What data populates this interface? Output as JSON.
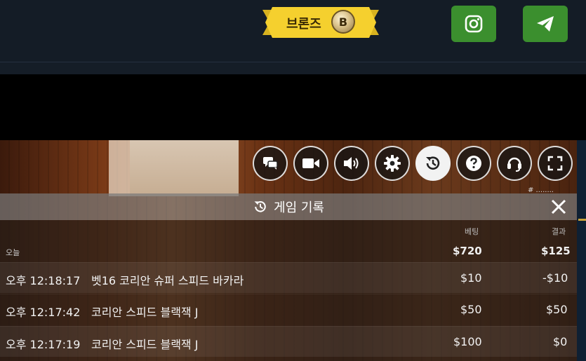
{
  "header": {
    "rank_label": "브론즈",
    "rank_coin_letter": "B",
    "rank_badge_color": "#f5d02e",
    "social": [
      {
        "name": "instagram-icon",
        "color": "#3b8f2e"
      },
      {
        "name": "telegram-icon",
        "color": "#3b8f2e"
      }
    ]
  },
  "video": {
    "corner_text": "# ........"
  },
  "controls": [
    {
      "name": "chat-icon"
    },
    {
      "name": "video-camera-icon"
    },
    {
      "name": "volume-icon"
    },
    {
      "name": "gear-icon"
    },
    {
      "name": "history-icon",
      "active": true
    },
    {
      "name": "help-icon"
    },
    {
      "name": "headset-icon"
    },
    {
      "name": "fullscreen-icon"
    }
  ],
  "history": {
    "title": "게임 기록",
    "columns": {
      "bet": "베팅",
      "result": "결과"
    },
    "today_label": "오늘",
    "today_bet": "$720",
    "today_result": "$125",
    "rows": [
      {
        "time": "오후 12:18:17",
        "game": "벳16 코리안 슈퍼 스피드 바카라",
        "bet": "$10",
        "result": "-$10"
      },
      {
        "time": "오후 12:17:42",
        "game": "코리안 스피드 블랙잭 J",
        "bet": "$50",
        "result": "$50"
      },
      {
        "time": "오후 12:17:19",
        "game": "코리안 스피드 블랙잭 J",
        "bet": "$100",
        "result": "$0"
      }
    ]
  }
}
